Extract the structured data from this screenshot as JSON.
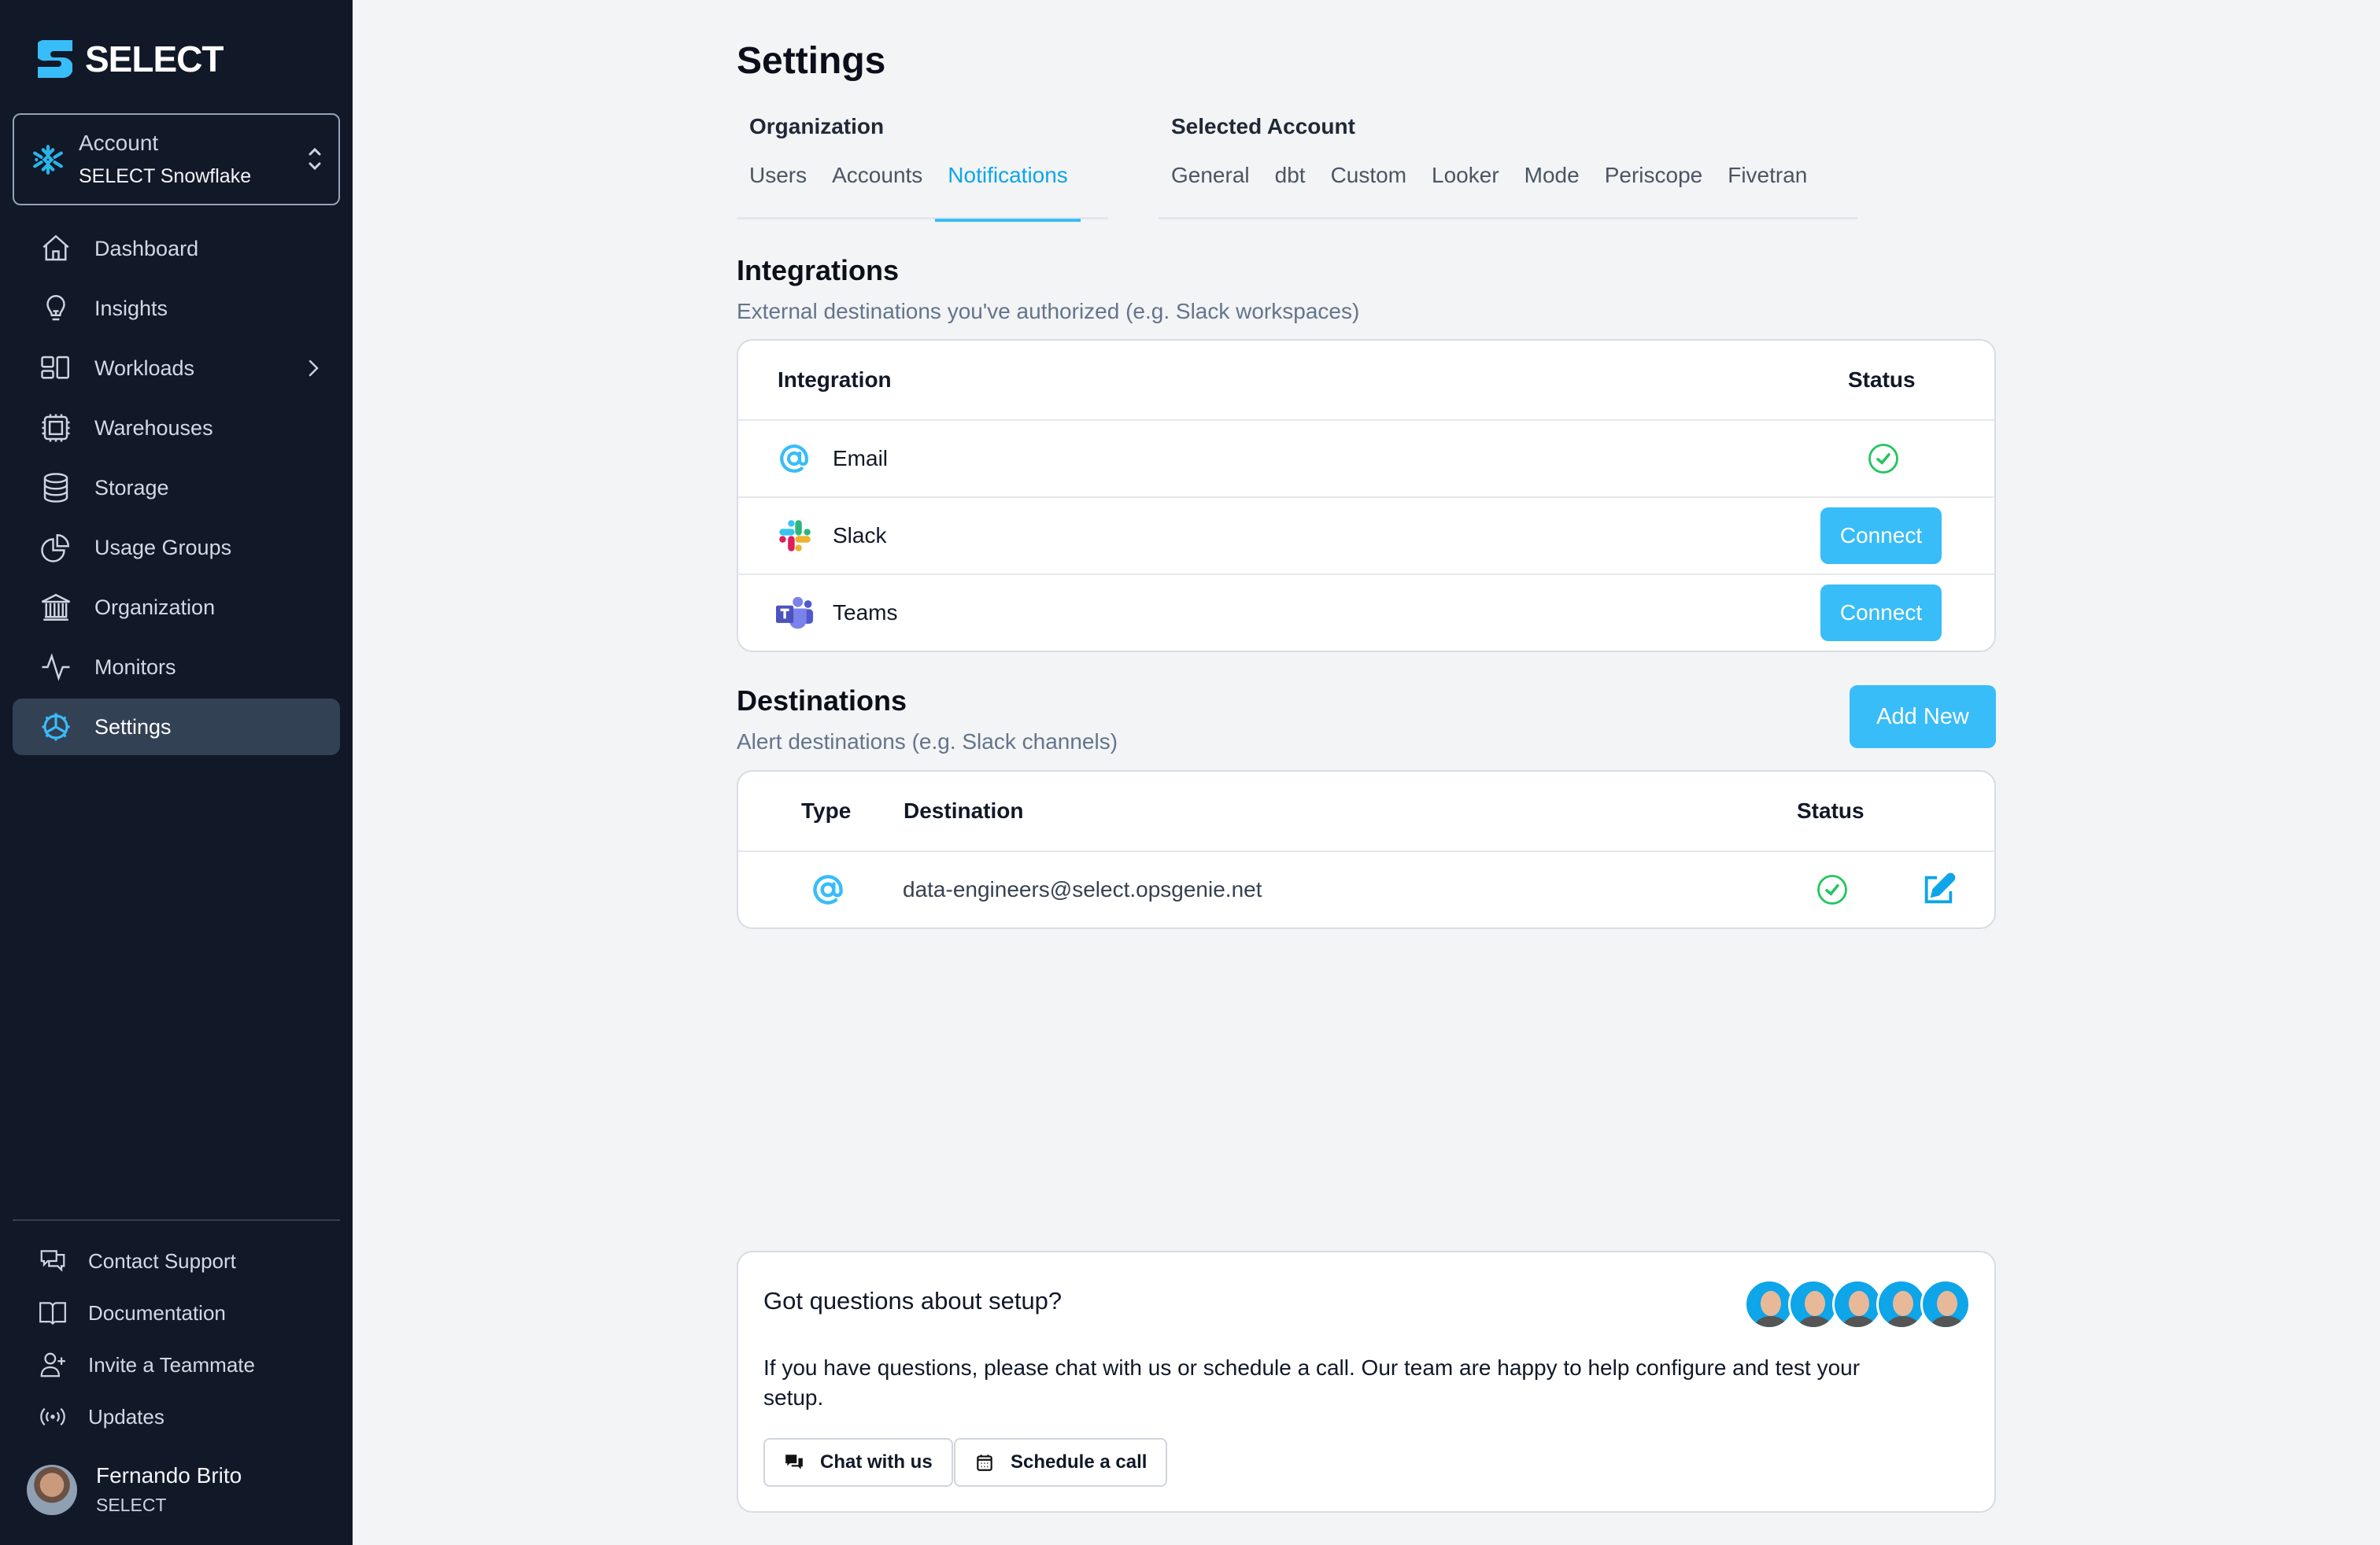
{
  "sidebar": {
    "brand": "SELECT",
    "account": {
      "label": "Account",
      "value": "SELECT Snowflake"
    },
    "nav": [
      {
        "label": "Dashboard",
        "icon": "home-icon"
      },
      {
        "label": "Insights",
        "icon": "lightbulb-icon"
      },
      {
        "label": "Workloads",
        "icon": "workloads-icon"
      },
      {
        "label": "Warehouses",
        "icon": "chip-icon"
      },
      {
        "label": "Storage",
        "icon": "database-icon"
      },
      {
        "label": "Usage Groups",
        "icon": "pie-chart-icon"
      },
      {
        "label": "Organization",
        "icon": "bank-icon"
      },
      {
        "label": "Monitors",
        "icon": "activity-icon"
      },
      {
        "label": "Settings",
        "icon": "gear-icon",
        "active": true
      }
    ],
    "bottom_nav": [
      {
        "label": "Contact Support",
        "icon": "chat-bubbles-icon"
      },
      {
        "label": "Documentation",
        "icon": "book-icon"
      },
      {
        "label": "Invite a Teammate",
        "icon": "user-plus-icon"
      },
      {
        "label": "Updates",
        "icon": "broadcast-icon"
      }
    ],
    "user": {
      "name": "Fernando Brito",
      "org": "SELECT"
    }
  },
  "main": {
    "title": "Settings",
    "tab_groups": [
      {
        "heading": "Organization",
        "tabs": [
          "Users",
          "Accounts",
          "Notifications"
        ],
        "active": "Notifications"
      },
      {
        "heading": "Selected Account",
        "tabs": [
          "General",
          "dbt",
          "Custom",
          "Looker",
          "Mode",
          "Periscope",
          "Fivetran"
        ]
      }
    ],
    "integrations": {
      "heading": "Integrations",
      "subtitle": "External destinations you've authorized (e.g. Slack workspaces)",
      "columns": [
        "Integration",
        "Status"
      ],
      "rows": [
        {
          "name": "Email",
          "icon": "at-sign-icon",
          "status": "connected"
        },
        {
          "name": "Slack",
          "icon": "slack-icon",
          "status": "not-connected",
          "action": "Connect"
        },
        {
          "name": "Teams",
          "icon": "teams-icon",
          "status": "not-connected",
          "action": "Connect"
        }
      ]
    },
    "destinations": {
      "heading": "Destinations",
      "subtitle": "Alert destinations (e.g. Slack channels)",
      "add_label": "Add New",
      "columns": [
        "Type",
        "Destination",
        "Status"
      ],
      "rows": [
        {
          "type": "email",
          "destination": "data-engineers@select.opsgenie.net",
          "status": "connected"
        }
      ]
    },
    "help": {
      "title": "Got questions about setup?",
      "body": "If you have questions, please chat with us or schedule a call. Our team are happy to help configure and test your setup.",
      "chat_label": "Chat with us",
      "schedule_label": "Schedule a call"
    }
  },
  "colors": {
    "sidebar_bg": "#111827",
    "accent": "#38bdf8",
    "success": "#22c55e",
    "page_bg": "#f3f4f6"
  }
}
